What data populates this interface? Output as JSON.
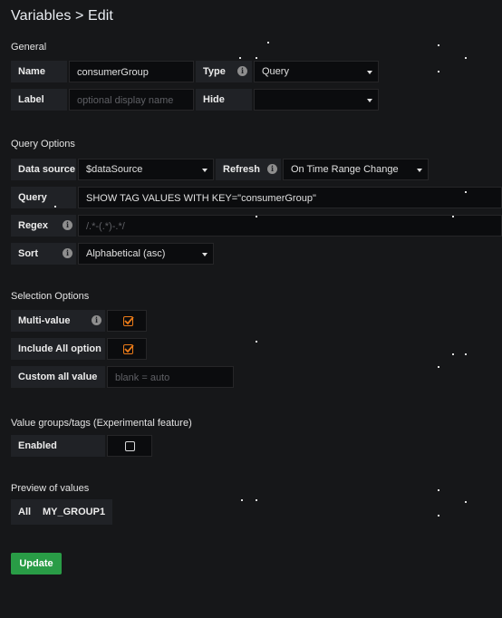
{
  "header": {
    "title": "Variables > Edit"
  },
  "general": {
    "section_title": "General",
    "name_label": "Name",
    "name_value": "consumerGroup",
    "type_label": "Type",
    "type_value": "Query",
    "label_label": "Label",
    "label_placeholder": "optional display name",
    "hide_label": "Hide",
    "hide_value": ""
  },
  "query_options": {
    "section_title": "Query Options",
    "datasource_label": "Data source",
    "datasource_value": "$dataSource",
    "refresh_label": "Refresh",
    "refresh_value": "On Time Range Change",
    "query_label": "Query",
    "query_value": "SHOW TAG VALUES WITH KEY=\"consumerGroup\"",
    "regex_label": "Regex",
    "regex_placeholder": "/.*-(.*)-.*/",
    "sort_label": "Sort",
    "sort_value": "Alphabetical (asc)"
  },
  "selection_options": {
    "section_title": "Selection Options",
    "multi_value_label": "Multi-value",
    "multi_value_checked": true,
    "include_all_label": "Include All option",
    "include_all_checked": true,
    "custom_all_label": "Custom all value",
    "custom_all_placeholder": "blank = auto"
  },
  "value_groups": {
    "section_title": "Value groups/tags (Experimental feature)",
    "enabled_label": "Enabled",
    "enabled_checked": false
  },
  "preview": {
    "section_title": "Preview of values",
    "values": [
      "All",
      "MY_GROUP1"
    ]
  },
  "actions": {
    "update_label": "Update"
  },
  "colors": {
    "background": "#161719",
    "label_bg": "#202226",
    "input_bg": "#0b0c0e",
    "checkbox_accent": "#eb7b18",
    "update_button": "#299c46"
  },
  "icons": {
    "info": "info-icon",
    "caret": "caret-down-icon",
    "check": "check-icon"
  }
}
